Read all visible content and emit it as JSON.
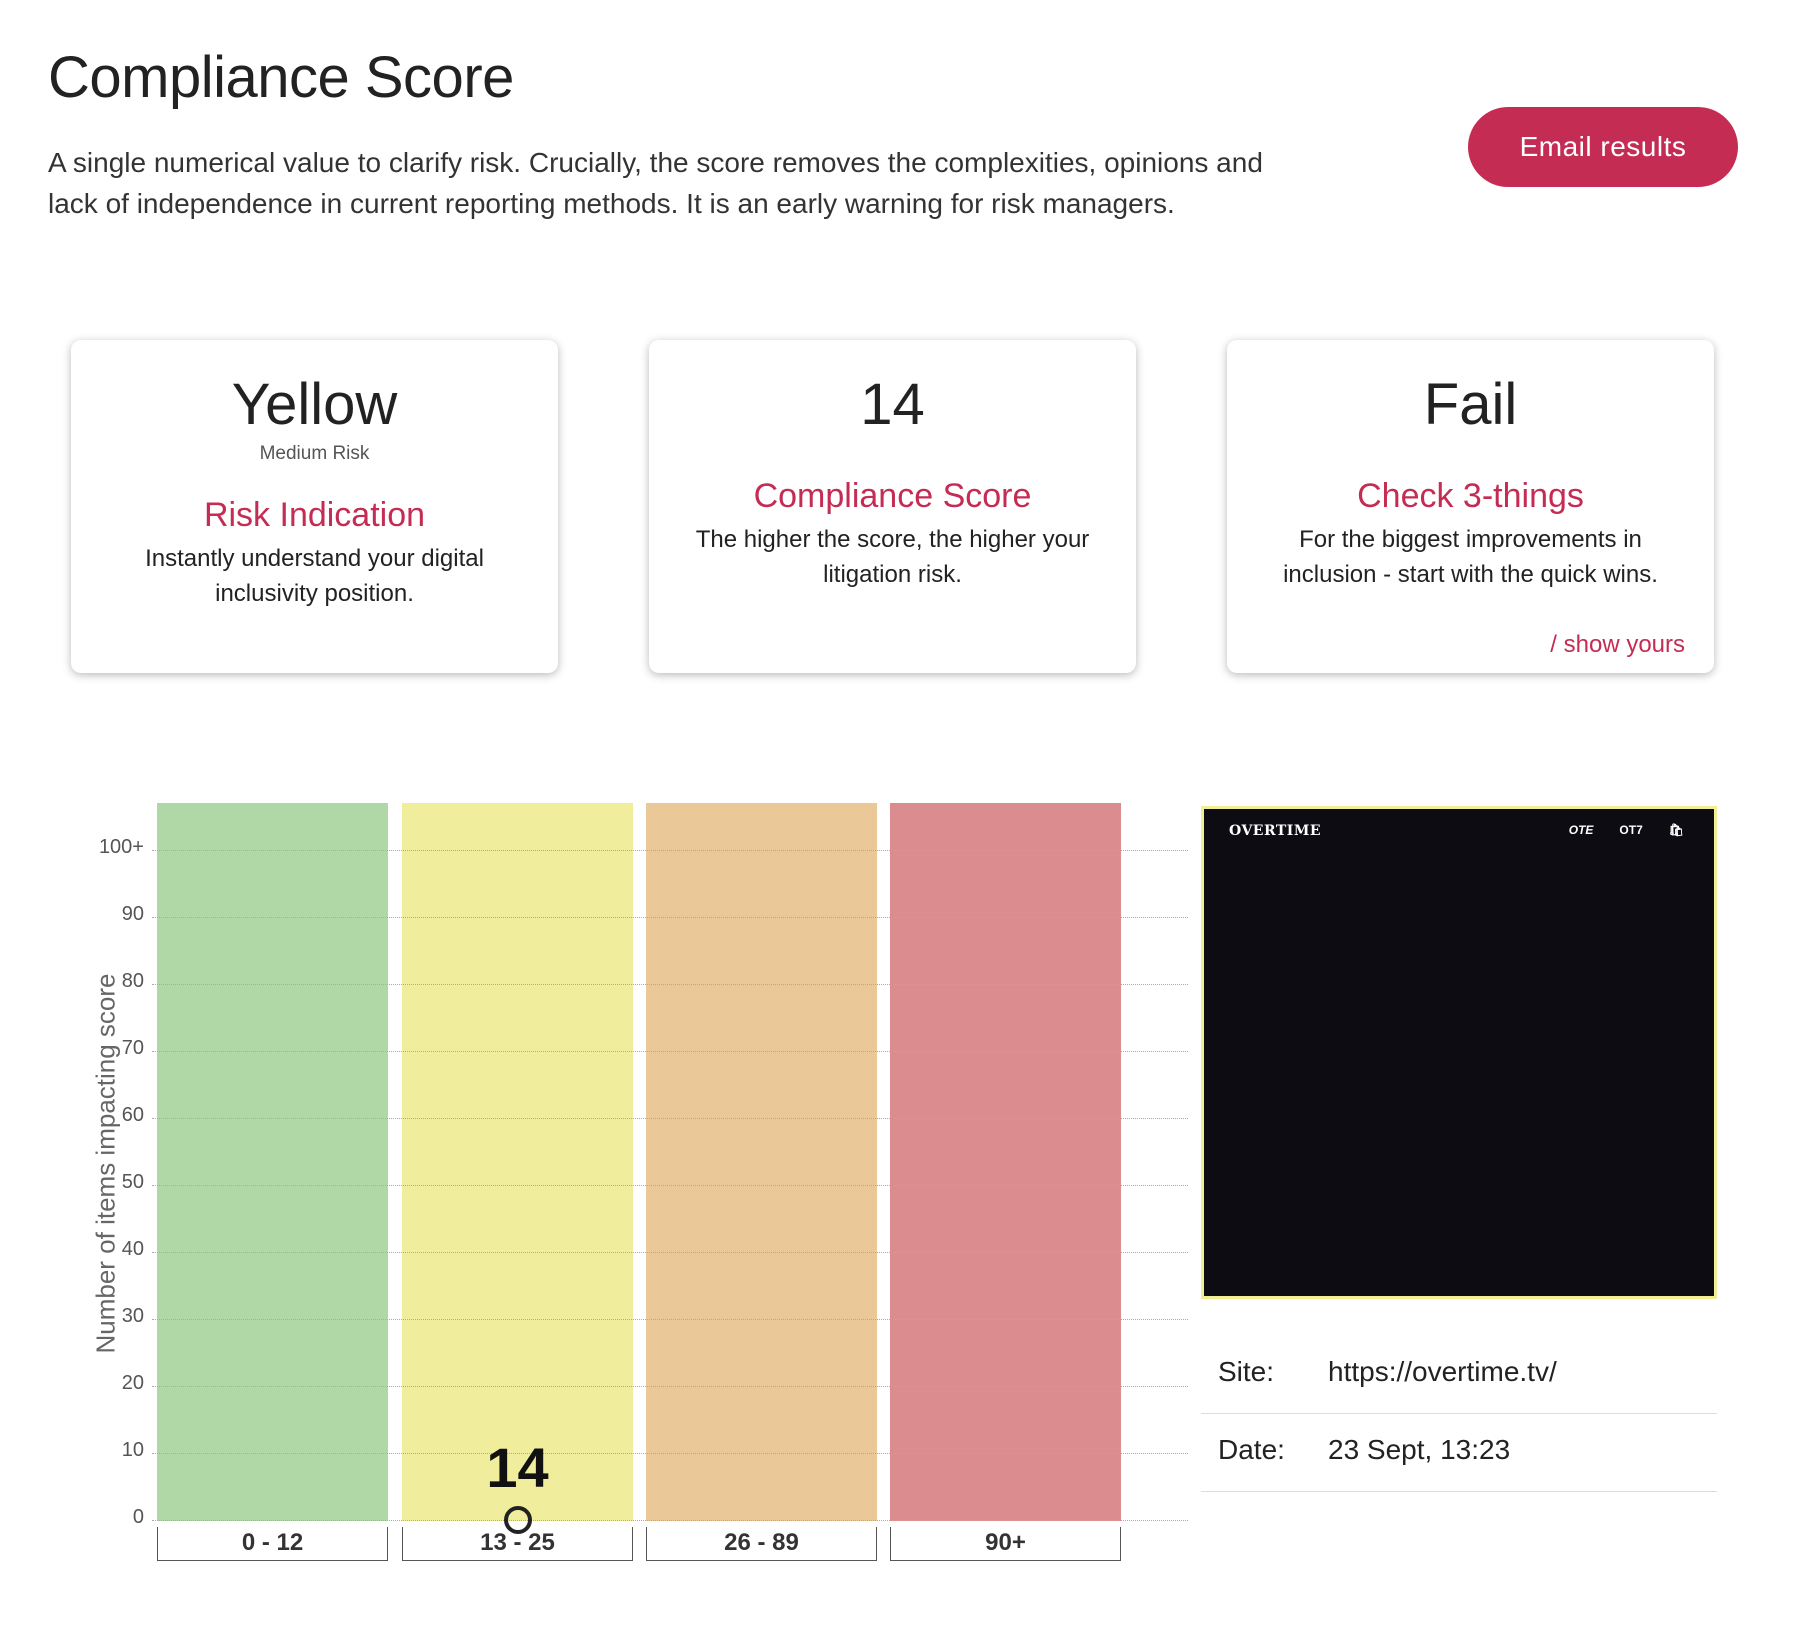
{
  "header": {
    "title": "Compliance Score",
    "intro": "A single numerical value to clarify risk. Crucially, the score removes the complexities, opinions and lack of independence in current reporting methods. It is an early warning for risk managers.",
    "email_button": "Email results"
  },
  "cards": [
    {
      "big": "Yellow",
      "sub": "Medium Risk",
      "heading": "Risk Indication",
      "body": "Instantly understand your digital inclusivity position."
    },
    {
      "big": "14",
      "heading": "Compliance Score",
      "body": "The higher the score, the higher your litigation risk."
    },
    {
      "big": "Fail",
      "heading": "Check 3-things",
      "body": "For the biggest improvements in inclusion - start with the quick wins.",
      "link": "/ show yours"
    }
  ],
  "colors": {
    "accent": "#c52c54",
    "green": "#b0d7a6",
    "yellow": "#f0ee9c",
    "orange": "#ebc897",
    "red": "#da8c8e"
  },
  "chart_data": {
    "type": "bar",
    "ylabel": "Number of items impacting score",
    "yticks": [
      "100+",
      "90",
      "80",
      "70",
      "60",
      "50",
      "40",
      "30",
      "20",
      "10",
      "0"
    ],
    "ylim": [
      0,
      100
    ],
    "categories": [
      "0 - 12",
      "13 - 25",
      "26 - 89",
      "90+"
    ],
    "band_colors": [
      "#b0d7a6",
      "#f0ee9c",
      "#ebc897",
      "#da8c8e"
    ],
    "score": 14,
    "score_band_index": 1,
    "grid": true
  },
  "preview": {
    "logo": "OVERTIME",
    "nav": [
      "OTE",
      "OT7",
      "🛍"
    ]
  },
  "meta": {
    "site_label": "Site:",
    "site_value": "https://overtime.tv/",
    "date_label": "Date:",
    "date_value": "23 Sept, 13:23"
  }
}
